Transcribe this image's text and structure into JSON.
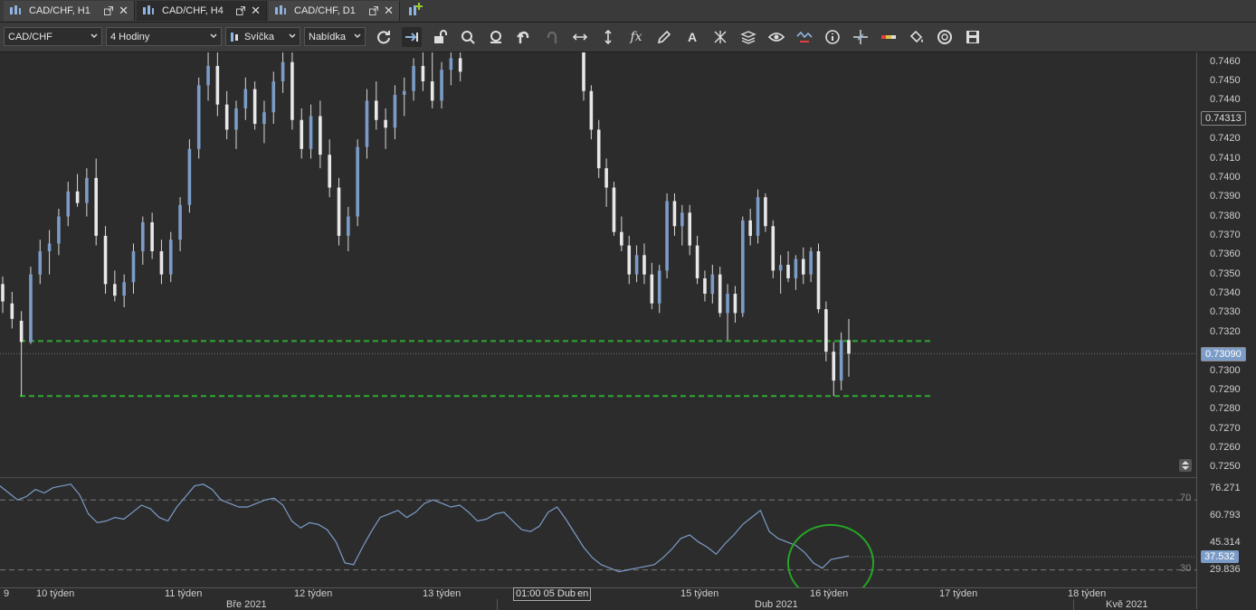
{
  "tabs": [
    {
      "label": "CAD/CHF, H1",
      "active": false
    },
    {
      "label": "CAD/CHF, H4",
      "active": true
    },
    {
      "label": "CAD/CHF, D1",
      "active": false
    }
  ],
  "toolbar": {
    "instrument": "CAD/CHF",
    "period": "4 Hodiny",
    "chart_type": "Svíčka",
    "side": "Nabídka",
    "fx_label": "fx",
    "text_tool_label": "A"
  },
  "price_axis": {
    "labels": [
      "0.7460",
      "0.7450",
      "0.7440",
      "0.7420",
      "0.7410",
      "0.7400",
      "0.7390",
      "0.7380",
      "0.7370",
      "0.7360",
      "0.7350",
      "0.7340",
      "0.7330",
      "0.7320",
      "0.7300",
      "0.7290",
      "0.7280",
      "0.7270",
      "0.7260",
      "0.7250"
    ],
    "label_values": [
      0.746,
      0.745,
      0.744,
      0.742,
      0.741,
      0.74,
      0.739,
      0.738,
      0.737,
      0.736,
      0.735,
      0.734,
      0.733,
      0.732,
      0.73,
      0.729,
      0.728,
      0.727,
      0.726,
      0.725
    ],
    "high_badge": "0.74313",
    "current_badge": "0.73090"
  },
  "rsi_axis": {
    "labels": [
      "76.271",
      "60.793",
      "45.314",
      "29.836"
    ],
    "current_badge": "37.532",
    "level_high": "70",
    "level_low": "30"
  },
  "time_axis": {
    "weeks": [
      "9",
      "10 týden",
      "11 týden",
      "12 týden",
      "13 týden",
      "15 týden",
      "16 týden",
      "17 týden",
      "18 týden"
    ],
    "months": [
      "Bře 2021",
      "Dub 2021",
      "Kvě 2021"
    ],
    "crosshair_label": "01:00 05 Dub",
    "crosshair_suffix": "en"
  },
  "chart_data": {
    "type": "candlestick",
    "instrument": "CAD/CHF",
    "timeframe": "4 Hodiny",
    "ylim": [
      0.7245,
      0.7465
    ],
    "support_levels": [
      0.73155,
      0.7287
    ],
    "current_price": 0.7309,
    "candles": [
      [
        0.7345,
        0.7349,
        0.733,
        0.7336
      ],
      [
        0.7335,
        0.7341,
        0.7322,
        0.7327
      ],
      [
        0.7326,
        0.7331,
        0.7287,
        0.7315
      ],
      [
        0.7315,
        0.7354,
        0.7314,
        0.735
      ],
      [
        0.735,
        0.7368,
        0.7345,
        0.7362
      ],
      [
        0.7362,
        0.7373,
        0.735,
        0.7366
      ],
      [
        0.7366,
        0.7384,
        0.736,
        0.738
      ],
      [
        0.738,
        0.7398,
        0.7375,
        0.7393
      ],
      [
        0.7393,
        0.7402,
        0.7385,
        0.7387
      ],
      [
        0.7387,
        0.7405,
        0.738,
        0.74
      ],
      [
        0.74,
        0.741,
        0.7365,
        0.737
      ],
      [
        0.737,
        0.7375,
        0.734,
        0.7345
      ],
      [
        0.7345,
        0.7352,
        0.7336,
        0.7339
      ],
      [
        0.7339,
        0.735,
        0.7333,
        0.7346
      ],
      [
        0.7346,
        0.7366,
        0.734,
        0.7362
      ],
      [
        0.7362,
        0.738,
        0.7355,
        0.7377
      ],
      [
        0.7377,
        0.7382,
        0.7358,
        0.7362
      ],
      [
        0.7362,
        0.7368,
        0.7345,
        0.735
      ],
      [
        0.735,
        0.7372,
        0.7346,
        0.7368
      ],
      [
        0.7368,
        0.739,
        0.7362,
        0.7386
      ],
      [
        0.7386,
        0.742,
        0.7382,
        0.7415
      ],
      [
        0.7415,
        0.7452,
        0.741,
        0.7448
      ],
      [
        0.7448,
        0.7465,
        0.744,
        0.7458
      ],
      [
        0.7458,
        0.7465,
        0.7432,
        0.7438
      ],
      [
        0.7438,
        0.7445,
        0.742,
        0.7425
      ],
      [
        0.7425,
        0.744,
        0.7415,
        0.7436
      ],
      [
        0.7436,
        0.7452,
        0.743,
        0.7446
      ],
      [
        0.7446,
        0.745,
        0.7425,
        0.7428
      ],
      [
        0.7428,
        0.744,
        0.7418,
        0.7434
      ],
      [
        0.7434,
        0.7455,
        0.7428,
        0.745
      ],
      [
        0.745,
        0.7465,
        0.7444,
        0.746
      ],
      [
        0.746,
        0.7465,
        0.7425,
        0.743
      ],
      [
        0.743,
        0.7436,
        0.741,
        0.7415
      ],
      [
        0.7415,
        0.7438,
        0.741,
        0.7432
      ],
      [
        0.7432,
        0.744,
        0.7405,
        0.7412
      ],
      [
        0.7412,
        0.742,
        0.739,
        0.7395
      ],
      [
        0.7395,
        0.74,
        0.7365,
        0.737
      ],
      [
        0.737,
        0.7385,
        0.7362,
        0.738
      ],
      [
        0.738,
        0.742,
        0.7375,
        0.7416
      ],
      [
        0.7416,
        0.7446,
        0.741,
        0.744
      ],
      [
        0.744,
        0.745,
        0.7425,
        0.743
      ],
      [
        0.743,
        0.7436,
        0.7415,
        0.7426
      ],
      [
        0.7426,
        0.7448,
        0.742,
        0.7443
      ],
      [
        0.7443,
        0.7452,
        0.7432,
        0.7445
      ],
      [
        0.7445,
        0.7462,
        0.744,
        0.7458
      ],
      [
        0.7458,
        0.7465,
        0.7445,
        0.745
      ],
      [
        0.745,
        0.7465,
        0.7436,
        0.744
      ],
      [
        0.744,
        0.746,
        0.7436,
        0.7456
      ],
      [
        0.7456,
        0.7465,
        0.7448,
        0.7462
      ],
      [
        0.7462,
        0.7465,
        0.745,
        0.7455
      ],
      [
        0.7465,
        0.7465,
        0.744,
        0.7445
      ],
      [
        0.7445,
        0.7448,
        0.742,
        0.7425
      ],
      [
        0.7425,
        0.743,
        0.74,
        0.7405
      ],
      [
        0.7405,
        0.741,
        0.7385,
        0.7395
      ],
      [
        0.7395,
        0.7398,
        0.737,
        0.7372
      ],
      [
        0.7372,
        0.738,
        0.7362,
        0.7365
      ],
      [
        0.7365,
        0.737,
        0.7345,
        0.735
      ],
      [
        0.735,
        0.7365,
        0.7346,
        0.736
      ],
      [
        0.736,
        0.7366,
        0.7345,
        0.735
      ],
      [
        0.735,
        0.7356,
        0.7332,
        0.7335
      ],
      [
        0.7335,
        0.7355,
        0.733,
        0.7352
      ],
      [
        0.7352,
        0.7392,
        0.7348,
        0.7388
      ],
      [
        0.7388,
        0.7392,
        0.737,
        0.7375
      ],
      [
        0.7375,
        0.7386,
        0.7365,
        0.7382
      ],
      [
        0.7382,
        0.7386,
        0.736,
        0.7365
      ],
      [
        0.7365,
        0.737,
        0.7345,
        0.7348
      ],
      [
        0.7348,
        0.7352,
        0.7336,
        0.734
      ],
      [
        0.734,
        0.7355,
        0.7335,
        0.735
      ],
      [
        0.735,
        0.7354,
        0.7328,
        0.733
      ],
      [
        0.733,
        0.7345,
        0.7316,
        0.734
      ],
      [
        0.734,
        0.7344,
        0.7325,
        0.733
      ],
      [
        0.733,
        0.738,
        0.7328,
        0.7378
      ],
      [
        0.7378,
        0.7384,
        0.7365,
        0.737
      ],
      [
        0.737,
        0.7394,
        0.7366,
        0.739
      ],
      [
        0.739,
        0.7392,
        0.7372,
        0.7375
      ],
      [
        0.7375,
        0.7378,
        0.7348,
        0.7352
      ],
      [
        0.7352,
        0.736,
        0.734,
        0.7355
      ],
      [
        0.7355,
        0.7362,
        0.7346,
        0.7348
      ],
      [
        0.7348,
        0.736,
        0.7342,
        0.7358
      ],
      [
        0.7358,
        0.7364,
        0.7345,
        0.735
      ],
      [
        0.735,
        0.7364,
        0.7346,
        0.7362
      ],
      [
        0.7362,
        0.7366,
        0.733,
        0.7332
      ],
      [
        0.7332,
        0.7336,
        0.7305,
        0.731
      ],
      [
        0.731,
        0.7315,
        0.7287,
        0.7295
      ],
      [
        0.7295,
        0.732,
        0.729,
        0.7316
      ],
      [
        0.7316,
        0.7327,
        0.7297,
        0.7309
      ]
    ]
  },
  "rsi_data": {
    "levels": [
      70,
      30
    ],
    "ylim": [
      20,
      82
    ],
    "values": [
      78,
      74,
      70,
      72,
      76,
      74,
      77,
      78,
      79,
      73,
      62,
      57,
      58,
      60,
      59,
      63,
      67,
      65,
      60,
      58,
      66,
      72,
      78,
      79,
      76,
      70,
      68,
      66,
      66,
      68,
      70,
      71,
      67,
      58,
      54,
      57,
      56,
      53,
      46,
      34,
      33,
      43,
      52,
      60,
      62,
      64,
      60,
      63,
      68,
      70,
      68,
      66,
      67,
      63,
      58,
      59,
      62,
      63,
      58,
      53,
      52,
      55,
      63,
      66,
      59,
      51,
      43,
      37,
      33,
      31,
      29,
      30,
      31,
      32,
      33,
      37,
      42,
      48,
      50,
      46,
      43,
      39,
      45,
      50,
      56,
      60,
      64,
      52,
      48,
      46,
      44,
      40,
      34,
      31,
      36,
      37,
      38
    ],
    "current": 37.532
  }
}
